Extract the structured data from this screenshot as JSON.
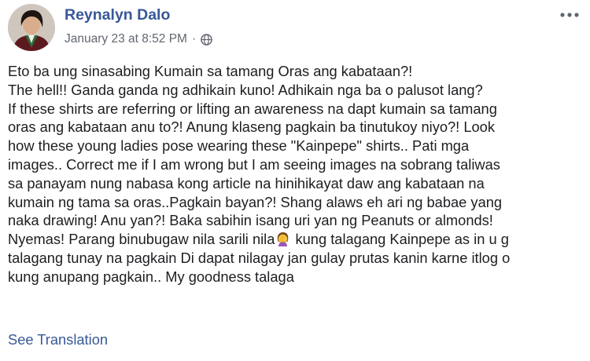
{
  "post": {
    "author": "Reynalyn Dalo",
    "timestamp": "January 23 at 8:52 PM",
    "separator": "·",
    "privacy_icon": "globe-icon",
    "more_icon": "more-options-icon",
    "avatar_icon": "profile-photo",
    "body_lines": [
      "Eto ba ung sinasabing Kumain sa tamang Oras ang kabataan?!",
      "The hell!! Ganda ganda ng adhikain kuno! Adhikain nga ba o palusot lang?",
      "If these shirts are referring or lifting an awareness na dapt kumain sa tamang",
      "oras ang kabataan anu to?! Anung klaseng pagkain ba tinutukoy niyo?! Look",
      "how these young ladies pose wearing these \"Kainpepe\" shirts.. Pati mga",
      "images.. Correct me if I am wrong but I am seeing images na sobrang taliwas",
      "sa panayam nung nabasa kong article na hinihikayat daw ang kabataan na",
      "kumain ng tama sa oras..Pagkain bayan?! Shang alaws eh ari ng babae yang",
      "naka drawing! Anu yan?! Baka sabihin isang uri yan ng Peanuts or almonds!"
    ],
    "line_emoji_before": "Nyemas! Parang binubugaw nila sarili nila",
    "line_emoji_after": " kung talagang Kainpepe as in u g",
    "emoji_icon": "woman-facepalming-emoji",
    "body_lines_end": [
      "talagang tunay na pagkain Di dapat nilagay jan gulay prutas kanin karne itlog o",
      "kung anupang pagkain.. My goodness talaga"
    ],
    "see_translation": "See Translation"
  },
  "colors": {
    "link": "#385898",
    "meta": "#616770",
    "text": "#1c1e21"
  }
}
